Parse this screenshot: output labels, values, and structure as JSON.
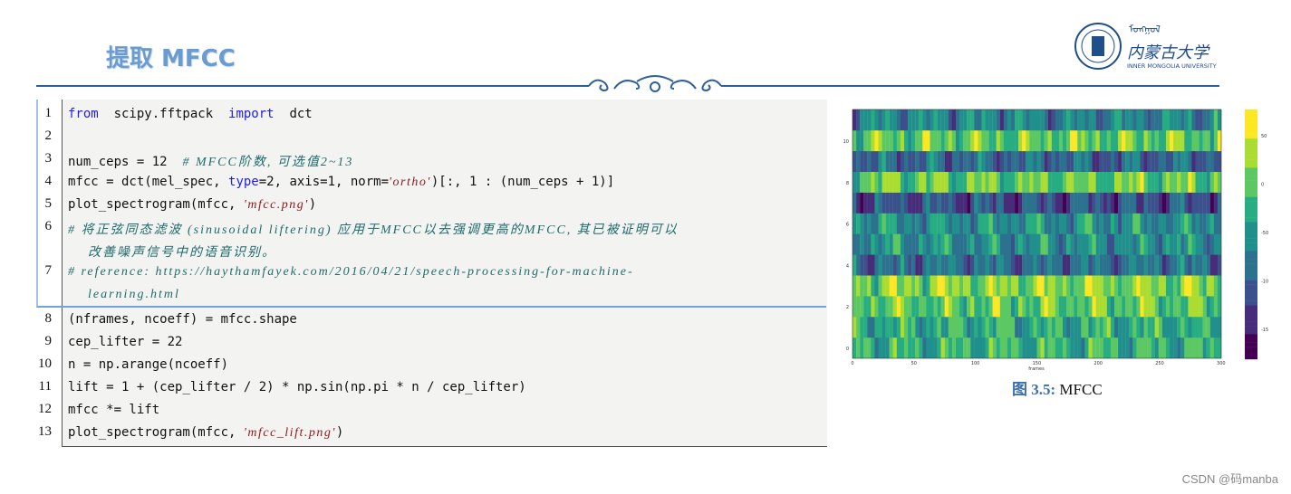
{
  "slide": {
    "title": "提取 MFCC",
    "university_cn": "内蒙古大学",
    "university_en": "INNER MONGOLIA UNIVERSITY",
    "watermark": "CSDN @码manba"
  },
  "code": {
    "lines": [
      {
        "n": "1",
        "t": [
          [
            "kw",
            "from"
          ],
          [
            "",
            "  scipy.fftpack  "
          ],
          [
            "kw",
            "import"
          ],
          [
            "",
            "  dct"
          ]
        ]
      },
      {
        "n": "2",
        "t": []
      },
      {
        "n": "3",
        "t": [
          [
            "",
            "num_ceps = 12  "
          ],
          [
            "cm",
            "# MFCC阶数, 可选值2~13"
          ]
        ]
      },
      {
        "n": "4",
        "t": [
          [
            "",
            "mfcc = dct(mel_spec, "
          ],
          [
            "kw",
            "type"
          ],
          [
            "",
            "=2, axis=1, norm="
          ],
          [
            "str",
            "'ortho'"
          ],
          [
            "",
            ")[:, 1 : (num_ceps + 1)]"
          ]
        ]
      },
      {
        "n": "5",
        "t": [
          [
            "",
            "plot_spectrogram(mfcc, "
          ],
          [
            "str",
            "'mfcc.png'"
          ],
          [
            "",
            ")"
          ]
        ]
      },
      {
        "n": "6",
        "t": [
          [
            "cm",
            "# 将正弦同态滤波 (sinusoidal liftering) 应用于MFCC以去强调更高的MFCC, 其已被证明可以"
          ]
        ]
      },
      {
        "n": "",
        "t": [
          [
            "cm",
            "    改善噪声信号中的语音识别。"
          ]
        ]
      },
      {
        "n": "7",
        "t": [
          [
            "cm",
            "# reference: https://haythamfayek.com/2016/04/21/speech-processing-for-machine-"
          ]
        ]
      },
      {
        "n": "",
        "t": [
          [
            "cm",
            "    learning.html"
          ]
        ]
      },
      {
        "n": "8",
        "t": [
          [
            "",
            "(nframes, ncoeff) = mfcc.shape"
          ]
        ]
      },
      {
        "n": "9",
        "t": [
          [
            "",
            "cep_lifter = 22"
          ]
        ]
      },
      {
        "n": "10",
        "t": [
          [
            "",
            "n = np.arange(ncoeff)"
          ]
        ]
      },
      {
        "n": "11",
        "t": [
          [
            "",
            "lift = 1 + (cep_lifter / 2) * np.sin(np.pi * n / cep_lifter)"
          ]
        ]
      },
      {
        "n": "12",
        "t": [
          [
            "",
            "mfcc *= lift"
          ]
        ]
      },
      {
        "n": "13",
        "t": [
          [
            "",
            "plot_spectrogram(mfcc, "
          ],
          [
            "str",
            "'mfcc_lift.png'"
          ],
          [
            "",
            ")"
          ]
        ]
      }
    ]
  },
  "figure": {
    "caption_label": "图 3.5:",
    "caption_text": "MFCC",
    "xlabel": "frames",
    "xticks": [
      "0",
      "50",
      "100",
      "150",
      "200",
      "250",
      "300"
    ],
    "yticks": [
      "0",
      "2",
      "4",
      "6",
      "8",
      "10"
    ],
    "colorbar_ticks": [
      "50",
      "0",
      "-50",
      "-100",
      "-150"
    ],
    "colormap": "viridis"
  },
  "colors": {
    "title": "#6a9bd1",
    "keyword": "#1d1df0",
    "string": "#8b1a1a",
    "comment": "#1f6b6b",
    "rule": "#2f5f9a"
  }
}
